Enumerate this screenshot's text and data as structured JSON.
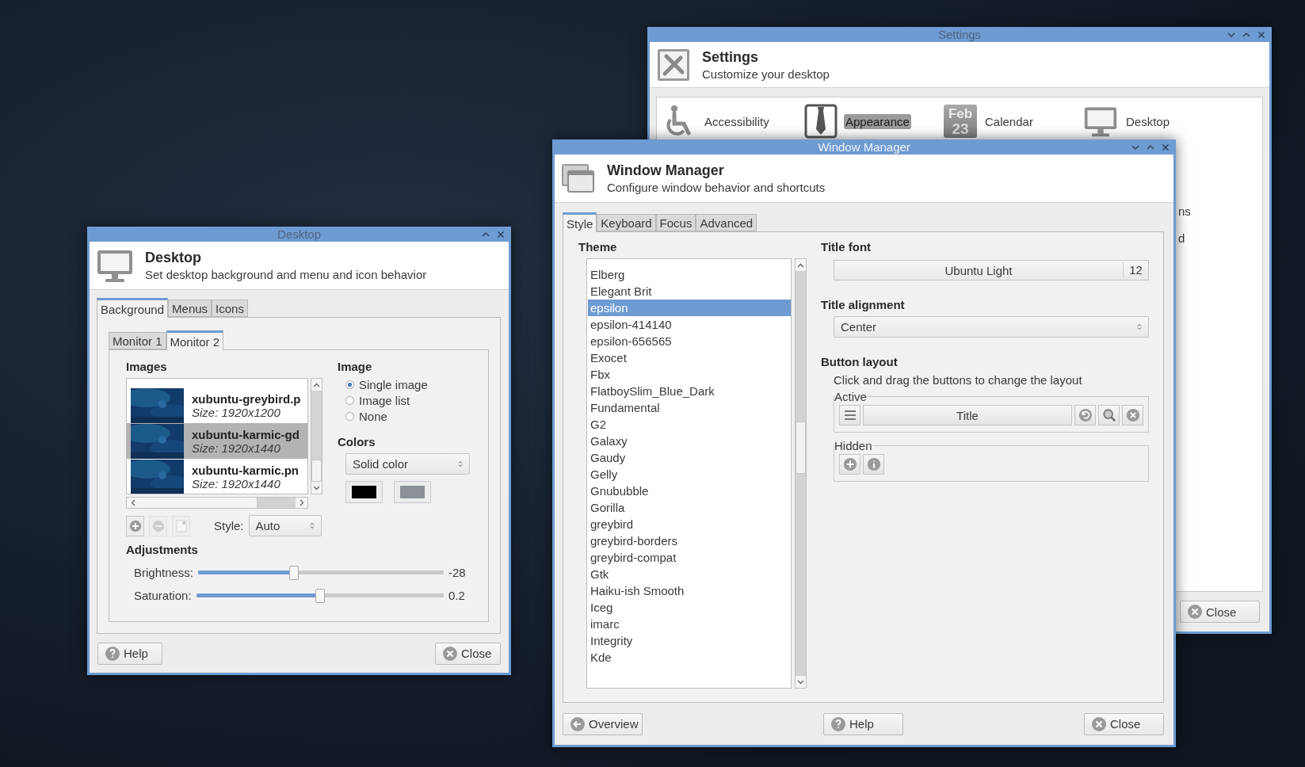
{
  "settings_window": {
    "title": "Settings",
    "active": false,
    "title_buttons": [
      {
        "kind": "minimize"
      },
      {
        "kind": "maximize"
      },
      {
        "kind": "close"
      }
    ],
    "heading": "Settings",
    "subtitle": "Customize your desktop",
    "items": [
      {
        "kind": "accessibility",
        "label": "Accessibility",
        "selected": false
      },
      {
        "kind": "appearance",
        "label": "Appearance",
        "selected": true
      },
      {
        "kind": "calendar",
        "label": "Calendar",
        "selected": false,
        "icon_lines": [
          "Feb",
          "23"
        ]
      },
      {
        "kind": "desktop",
        "label": "Desktop",
        "selected": false
      }
    ],
    "partial_items": [
      "ns",
      "d"
    ],
    "buttons": [
      {
        "kind": "close",
        "label": "Close"
      }
    ]
  },
  "window_manager": {
    "title": "Window Manager",
    "active": true,
    "title_buttons": [
      {
        "kind": "minimize"
      },
      {
        "kind": "maximize"
      },
      {
        "kind": "close"
      }
    ],
    "heading": "Window Manager",
    "subtitle": "Configure window behavior and shortcuts",
    "tabs": [
      {
        "label": "Style",
        "selected": true
      },
      {
        "label": "Keyboard",
        "selected": false
      },
      {
        "label": "Focus",
        "selected": false
      },
      {
        "label": "Advanced",
        "selected": false
      }
    ],
    "theme_label": "Theme",
    "themes": [
      {
        "label": "Elberg",
        "selected": false
      },
      {
        "label": "Elegant Brit",
        "selected": false
      },
      {
        "label": "epsilon",
        "selected": true
      },
      {
        "label": "epsilon-414140",
        "selected": false
      },
      {
        "label": "epsilon-656565",
        "selected": false
      },
      {
        "label": "Exocet",
        "selected": false
      },
      {
        "label": "Fbx",
        "selected": false
      },
      {
        "label": "FlatboySlim_Blue_Dark",
        "selected": false
      },
      {
        "label": "Fundamental",
        "selected": false
      },
      {
        "label": "G2",
        "selected": false
      },
      {
        "label": "Galaxy",
        "selected": false
      },
      {
        "label": "Gaudy",
        "selected": false
      },
      {
        "label": "Gelly",
        "selected": false
      },
      {
        "label": "Gnububble",
        "selected": false
      },
      {
        "label": "Gorilla",
        "selected": false
      },
      {
        "label": "greybird",
        "selected": false
      },
      {
        "label": "greybird-borders",
        "selected": false
      },
      {
        "label": "greybird-compat",
        "selected": false
      },
      {
        "label": "Gtk",
        "selected": false
      },
      {
        "label": "Haiku-ish Smooth",
        "selected": false
      },
      {
        "label": "Iceg",
        "selected": false
      },
      {
        "label": "imarc",
        "selected": false
      },
      {
        "label": "Integrity",
        "selected": false
      },
      {
        "label": "Kde",
        "selected": false
      }
    ],
    "title_font_label": "Title font",
    "title_font": "Ubuntu Light",
    "title_font_size": "12",
    "title_alignment_label": "Title alignment",
    "title_alignment": "Center",
    "button_layout_label": "Button layout",
    "button_layout_hint": "Click and drag the buttons to change the layout",
    "active_label": "Active",
    "active_buttons": [
      {
        "kind": "menu"
      },
      {
        "kind": "title",
        "label": "Title"
      },
      {
        "kind": "undo"
      },
      {
        "kind": "zoom"
      },
      {
        "kind": "close"
      }
    ],
    "hidden_label": "Hidden",
    "hidden_buttons": [
      {
        "kind": "plus"
      },
      {
        "kind": "info"
      }
    ],
    "buttons": [
      {
        "kind": "overview",
        "label": "Overview"
      },
      {
        "kind": "help",
        "label": "Help"
      },
      {
        "kind": "close",
        "label": "Close"
      }
    ]
  },
  "desktop_window": {
    "title": "Desktop",
    "active": false,
    "title_buttons": [
      {
        "kind": "maximize"
      },
      {
        "kind": "close"
      }
    ],
    "heading": "Desktop",
    "subtitle": "Set desktop background and menu and icon behavior",
    "tabs": [
      {
        "label": "Background",
        "selected": true
      },
      {
        "label": "Menus",
        "selected": false
      },
      {
        "label": "Icons",
        "selected": false
      }
    ],
    "monitor_tabs": [
      {
        "label": "Monitor 1",
        "selected": false
      },
      {
        "label": "Monitor 2",
        "selected": true
      }
    ],
    "images_label": "Images",
    "images": [
      {
        "name": "xubuntu-greybird.p",
        "size": "Size: 1920x1200",
        "selected": false
      },
      {
        "name": "xubuntu-karmic-gd",
        "size": "Size: 1920x1440",
        "selected": true
      },
      {
        "name": "xubuntu-karmic.pn",
        "size": "Size: 1920x1440",
        "selected": false
      }
    ],
    "image_tools": [
      {
        "kind": "add",
        "disabled": false
      },
      {
        "kind": "remove",
        "disabled": true
      },
      {
        "kind": "refresh",
        "disabled": true
      }
    ],
    "style_label": "Style:",
    "style": "Auto",
    "image_label": "Image",
    "image_modes": [
      {
        "label": "Single image",
        "selected": true
      },
      {
        "label": "Image list",
        "selected": false
      },
      {
        "label": "None",
        "selected": false
      }
    ],
    "colors_label": "Colors",
    "color_mode": "Solid color",
    "colors": [
      {
        "color": "#000000"
      },
      {
        "color": "#8c9198"
      }
    ],
    "adjustments_label": "Adjustments",
    "adjustments": [
      {
        "label": "Brightness:",
        "level": 0.39,
        "reading": "-28"
      },
      {
        "label": "Saturation:",
        "level": 0.5,
        "reading": "0.2"
      }
    ],
    "buttons": [
      {
        "kind": "help",
        "label": "Help"
      },
      {
        "kind": "close",
        "label": "Close"
      }
    ]
  }
}
